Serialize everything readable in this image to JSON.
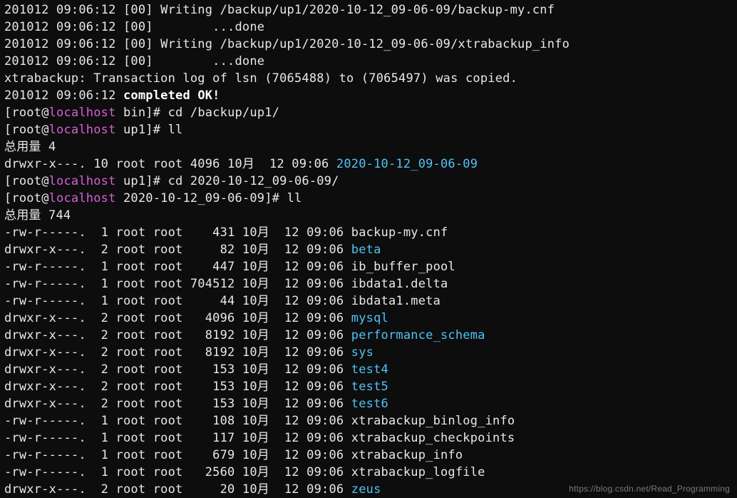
{
  "watermark": "https://blog.csdn.net/Read_Programming",
  "prompts": {
    "user": "root",
    "at": "@",
    "host": "localhost",
    "bin": "bin",
    "up1": "up1",
    "longdir": "2020-10-12_09-06-09",
    "hash": "]# ",
    "open": "[",
    "space": " "
  },
  "cmds": {
    "cd_up1": "cd /backup/up1/",
    "ll": "ll",
    "cd_dir": "cd 2020-10-12_09-06-09/"
  },
  "pre_lines": {
    "l1a": "201012 09:06:12 [00] Writing /backup/up1/2020-10-12_09-06-09/backup-my.cnf",
    "l2a": "201012 09:06:12 [00]        ...done",
    "l3a": "201012 09:06:12 [00] Writing /backup/up1/2020-10-12_09-06-09/xtrabackup_info",
    "l4a": "201012 09:06:12 [00]        ...done",
    "l5a": "xtrabackup: Transaction log of lsn (7065488) to (7065497) was copied.",
    "l6a": "201012 09:06:12 ",
    "l6b": "completed OK!"
  },
  "listing1": {
    "total": "总用量 4",
    "row_pre": "drwxr-x---. 10 root root 4096 10月  12 09:06 ",
    "row_name": "2020-10-12_09-06-09"
  },
  "listing2": {
    "total": "总用量 744",
    "rows": [
      {
        "pre": "-rw-r-----.  1 root root    431 10月  12 09:06 ",
        "name": "backup-my.cnf",
        "dir": false
      },
      {
        "pre": "drwxr-x---.  2 root root     82 10月  12 09:06 ",
        "name": "beta",
        "dir": true
      },
      {
        "pre": "-rw-r-----.  1 root root    447 10月  12 09:06 ",
        "name": "ib_buffer_pool",
        "dir": false
      },
      {
        "pre": "-rw-r-----.  1 root root 704512 10月  12 09:06 ",
        "name": "ibdata1.delta",
        "dir": false
      },
      {
        "pre": "-rw-r-----.  1 root root     44 10月  12 09:06 ",
        "name": "ibdata1.meta",
        "dir": false
      },
      {
        "pre": "drwxr-x---.  2 root root   4096 10月  12 09:06 ",
        "name": "mysql",
        "dir": true
      },
      {
        "pre": "drwxr-x---.  2 root root   8192 10月  12 09:06 ",
        "name": "performance_schema",
        "dir": true
      },
      {
        "pre": "drwxr-x---.  2 root root   8192 10月  12 09:06 ",
        "name": "sys",
        "dir": true
      },
      {
        "pre": "drwxr-x---.  2 root root    153 10月  12 09:06 ",
        "name": "test4",
        "dir": true
      },
      {
        "pre": "drwxr-x---.  2 root root    153 10月  12 09:06 ",
        "name": "test5",
        "dir": true
      },
      {
        "pre": "drwxr-x---.  2 root root    153 10月  12 09:06 ",
        "name": "test6",
        "dir": true
      },
      {
        "pre": "-rw-r-----.  1 root root    108 10月  12 09:06 ",
        "name": "xtrabackup_binlog_info",
        "dir": false
      },
      {
        "pre": "-rw-r-----.  1 root root    117 10月  12 09:06 ",
        "name": "xtrabackup_checkpoints",
        "dir": false
      },
      {
        "pre": "-rw-r-----.  1 root root    679 10月  12 09:06 ",
        "name": "xtrabackup_info",
        "dir": false
      },
      {
        "pre": "-rw-r-----.  1 root root   2560 10月  12 09:06 ",
        "name": "xtrabackup_logfile",
        "dir": false
      },
      {
        "pre": "drwxr-x---.  2 root root     20 10月  12 09:06 ",
        "name": "zeus",
        "dir": true
      }
    ]
  }
}
